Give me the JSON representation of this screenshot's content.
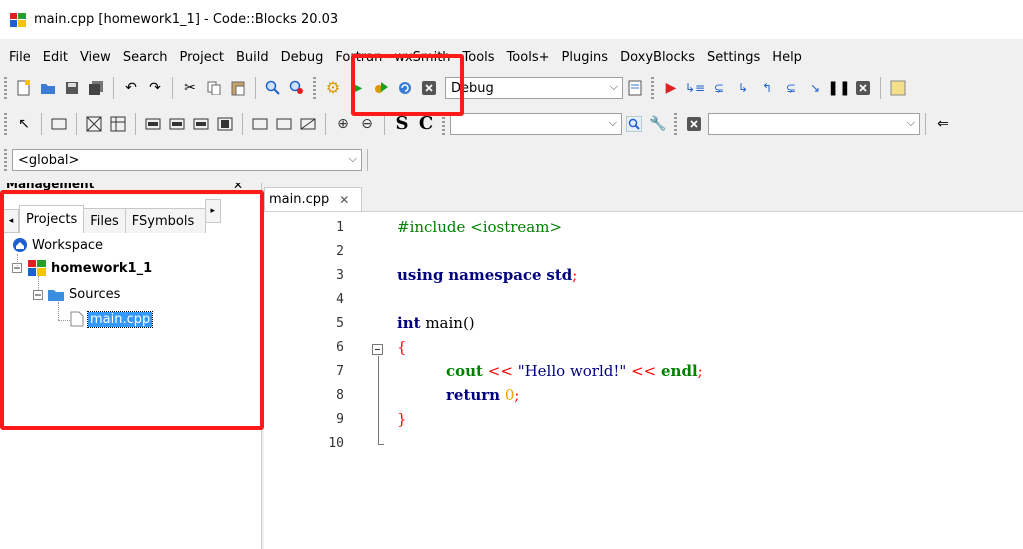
{
  "window": {
    "title": "main.cpp [homework1_1] - Code::Blocks 20.03"
  },
  "menu": [
    "File",
    "Edit",
    "View",
    "Search",
    "Project",
    "Build",
    "Debug",
    "Fortran",
    "wxSmith",
    "Tools",
    "Tools+",
    "Plugins",
    "DoxyBlocks",
    "Settings",
    "Help"
  ],
  "toolbar": {
    "build_target": "Debug",
    "scope": "<global>"
  },
  "management": {
    "header": "Management",
    "tabs": [
      "Projects",
      "Files",
      "FSymbols"
    ],
    "tree": {
      "workspace": "Workspace",
      "project": "homework1_1",
      "folder": "Sources",
      "file": "main.cpp"
    }
  },
  "editor": {
    "tab_label": "main.cpp",
    "line_numbers": [
      "1",
      "2",
      "3",
      "4",
      "5",
      "6",
      "7",
      "8",
      "9",
      "10"
    ],
    "code": {
      "l1": "#include <iostream>",
      "l3_kw1": "using",
      "l3_kw2": "namespace",
      "l3_id": "std",
      "l5_kw": "int",
      "l5_id": "main()",
      "l6": "{",
      "l7_id": "cout",
      "l7_op1": "<<",
      "l7_str": "\"Hello world!\"",
      "l7_op2": "<<",
      "l7_endl": "endl",
      "l8_kw": "return",
      "l8_num": "0",
      "l9": "}"
    }
  },
  "colors": {
    "highlight_red": "#ff1a1a",
    "selection_blue": "#3399ff",
    "keyword": "#00007f",
    "preprocessor": "#008000",
    "operator": "#ff0000",
    "number": "#f0a000"
  }
}
